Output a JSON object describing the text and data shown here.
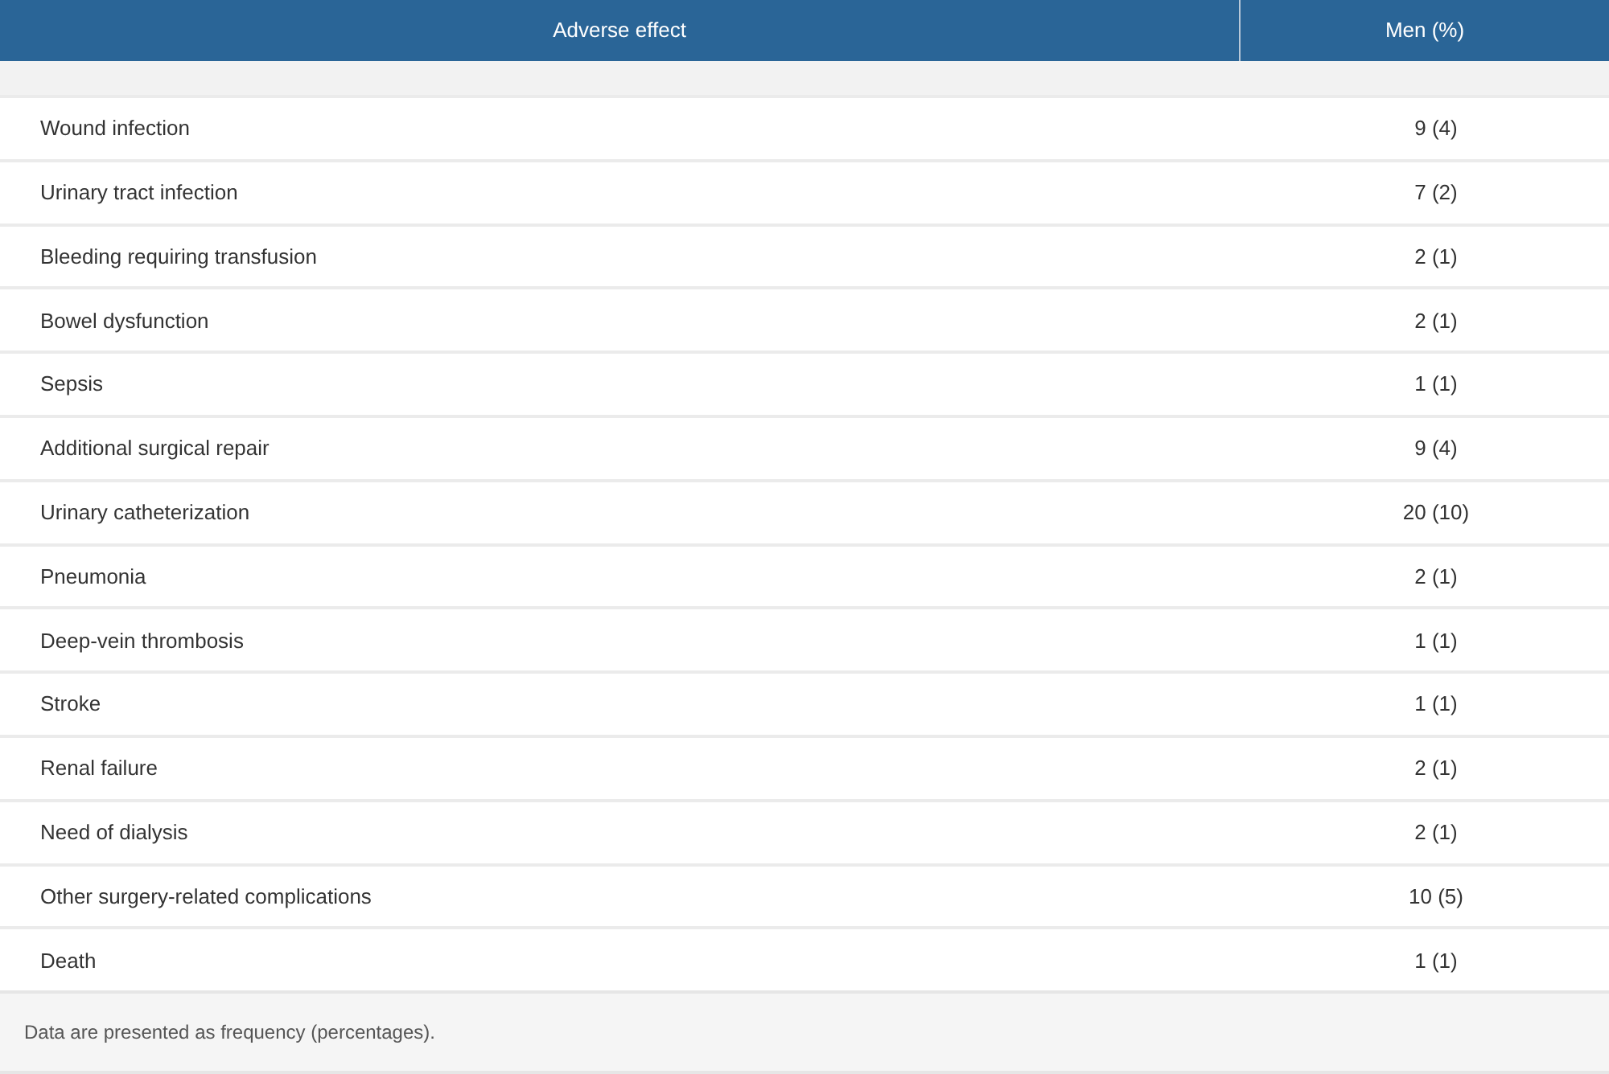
{
  "table": {
    "columns": [
      "Adverse effect",
      "Men (%)"
    ],
    "rows": [
      {
        "effect": "Wound infection",
        "men": "9 (4)"
      },
      {
        "effect": "Urinary tract infection",
        "men": "7 (2)"
      },
      {
        "effect": "Bleeding requiring transfusion",
        "men": "2 (1)"
      },
      {
        "effect": "Bowel dysfunction",
        "men": "2 (1)"
      },
      {
        "effect": "Sepsis",
        "men": "1 (1)"
      },
      {
        "effect": "Additional surgical repair",
        "men": "9 (4)"
      },
      {
        "effect": "Urinary catheterization",
        "men": "20 (10)"
      },
      {
        "effect": "Pneumonia",
        "men": "2 (1)"
      },
      {
        "effect": "Deep-vein thrombosis",
        "men": "1 (1)"
      },
      {
        "effect": "Stroke",
        "men": "1 (1)"
      },
      {
        "effect": "Renal failure",
        "men": "2 (1)"
      },
      {
        "effect": "Need of dialysis",
        "men": "2 (1)"
      },
      {
        "effect": "Other surgery-related complications",
        "men": "10 (5)"
      },
      {
        "effect": "Death",
        "men": "1 (1)"
      }
    ]
  },
  "footnote": "Data are presented as frequency (percentages)."
}
